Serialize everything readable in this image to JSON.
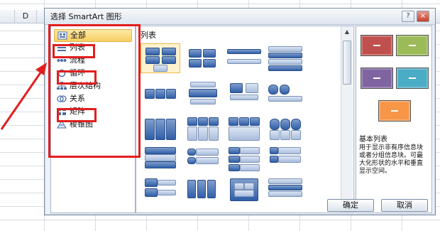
{
  "sheet": {
    "column_d": "D"
  },
  "dialog": {
    "title": "选择 SmartArt 图形",
    "help": "?",
    "close": "×",
    "categories": [
      {
        "label": "全部",
        "icon": "all-layouts-icon"
      },
      {
        "label": "列表",
        "icon": "list-icon"
      },
      {
        "label": "流程",
        "icon": "process-icon"
      },
      {
        "label": "循环",
        "icon": "cycle-icon"
      },
      {
        "label": "层次结构",
        "icon": "hierarchy-icon"
      },
      {
        "label": "关系",
        "icon": "relationship-icon"
      },
      {
        "label": "矩阵",
        "icon": "matrix-icon"
      },
      {
        "label": "棱锥图",
        "icon": "pyramid-icon"
      }
    ],
    "gallery_title": "列表",
    "preview": {
      "name": "基本列表",
      "description": "用于显示非有序信息块或者分组信息块。可最大化形状的水平和垂直显示空间。",
      "colors": [
        "#c0504d",
        "#9bbb59",
        "#8064a2",
        "#4bacc6",
        "#f79646"
      ]
    },
    "ok": "确定",
    "cancel": "取消"
  },
  "colors": {
    "annotation": "#e21e1e",
    "selection": "#f8cf61"
  }
}
